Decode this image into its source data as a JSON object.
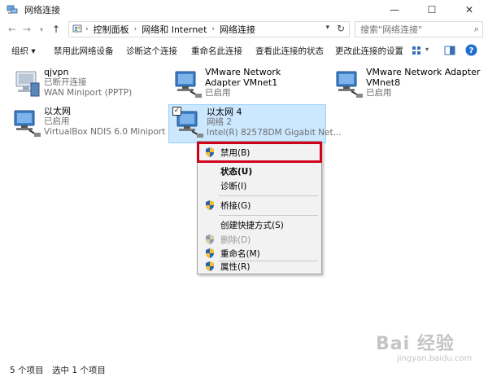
{
  "window": {
    "title": "网络连接",
    "controls": {
      "minimize": "—",
      "maximize": "☐",
      "close": "✕"
    }
  },
  "address": {
    "breadcrumbs": [
      "控制面板",
      "网络和 Internet",
      "网络连接"
    ],
    "search_placeholder": "搜索\"网络连接\""
  },
  "command_bar": {
    "items": [
      "组织 ▾",
      "禁用此网络设备",
      "诊断这个连接",
      "重命名此连接",
      "查看此连接的状态",
      "更改此连接的设置"
    ],
    "right_icons": [
      "view-options-icon",
      "preview-pane-icon",
      "help-icon"
    ]
  },
  "connections": [
    {
      "name": "qjvpn",
      "status": "已断开连接",
      "device": "WAN Miniport (PPTP)"
    },
    {
      "name": "VMware Network Adapter VMnet1",
      "status": "已启用",
      "device": ""
    },
    {
      "name": "VMware Network Adapter VMnet8",
      "status": "已启用",
      "device": ""
    },
    {
      "name": "以太网",
      "status": "已启用",
      "device": "VirtualBox NDIS 6.0 Miniport ..."
    },
    {
      "name": "以太网 4",
      "status": "网络  2",
      "device": "Intel(R) 82578DM Gigabit Net..."
    }
  ],
  "context_menu": {
    "disable": "禁用(B)",
    "status": "状态(U)",
    "diagnose": "诊断(I)",
    "bridge": "桥接(G)",
    "shortcut": "创建快捷方式(S)",
    "delete": "删除(D)",
    "rename": "重命名(M)",
    "properties": "属性(R)"
  },
  "status_bar": {
    "count": "5 个项目",
    "selected": "选中 1 个项目"
  },
  "watermark": {
    "line1": "Bai 经验",
    "line2": "jingyan.baidu.com"
  },
  "colors": {
    "selection_bg": "#cce8ff",
    "highlight_border": "#d0021b",
    "menu_bg": "#f2f2f2"
  }
}
